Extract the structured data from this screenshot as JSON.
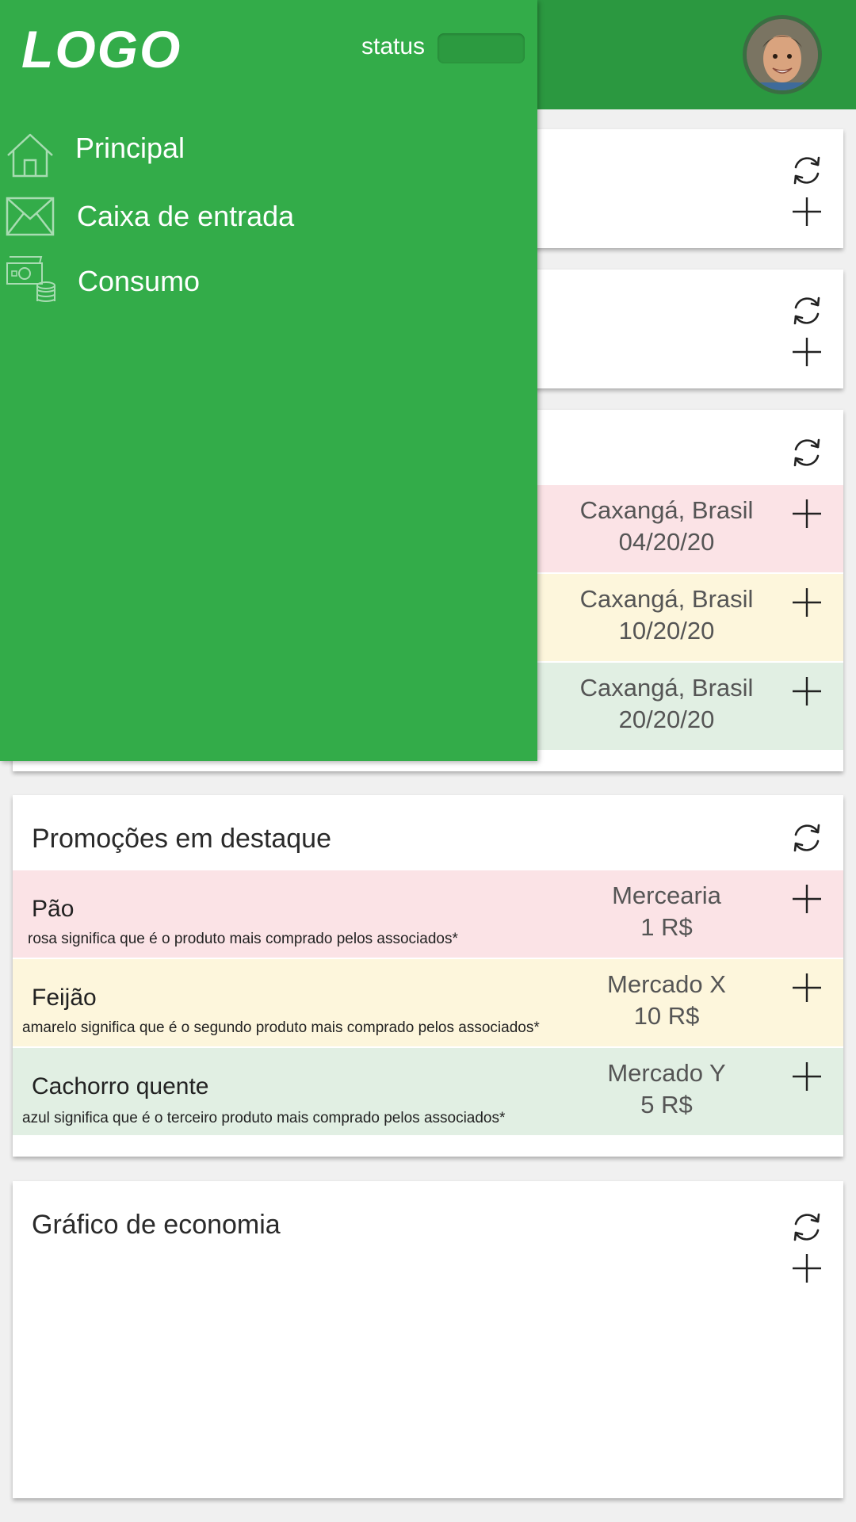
{
  "header": {
    "status_label": "status"
  },
  "drawer": {
    "logo": "LOGO",
    "items": [
      {
        "label": "Principal",
        "icon": "home-icon"
      },
      {
        "label": "Caixa de entrada",
        "icon": "mail-icon"
      },
      {
        "label": "Consumo",
        "icon": "money-icon"
      }
    ]
  },
  "visits": {
    "rows": [
      {
        "place": "Caxangá, Brasil",
        "date": "04/20/20",
        "color": "#fbe3e6"
      },
      {
        "place": "Caxangá, Brasil",
        "date": "10/20/20",
        "color": "#fdf6dc"
      },
      {
        "place": "Caxangá, Brasil",
        "date": "20/20/20",
        "color": "#e1efe3"
      }
    ]
  },
  "promotions": {
    "title": "Promoções em destaque",
    "rows": [
      {
        "name": "Pão",
        "note": "rosa significa que é o produto mais comprado pelos associados*",
        "store": "Mercearia",
        "price": "1 R$",
        "color": "#fbe3e6"
      },
      {
        "name": "Feijão",
        "note": "amarelo significa que é o segundo produto mais comprado pelos associados*",
        "store": "Mercado X",
        "price": "10 R$",
        "color": "#fdf6dc"
      },
      {
        "name": "Cachorro quente",
        "note": "azul significa que é o terceiro produto mais comprado pelos associados*",
        "store": "Mercado Y",
        "price": "5 R$",
        "color": "#e1efe3"
      }
    ]
  },
  "savings": {
    "title": "Gráfico de economia"
  },
  "colors": {
    "header_green": "#2b9840",
    "drawer_green": "#33ac49"
  }
}
